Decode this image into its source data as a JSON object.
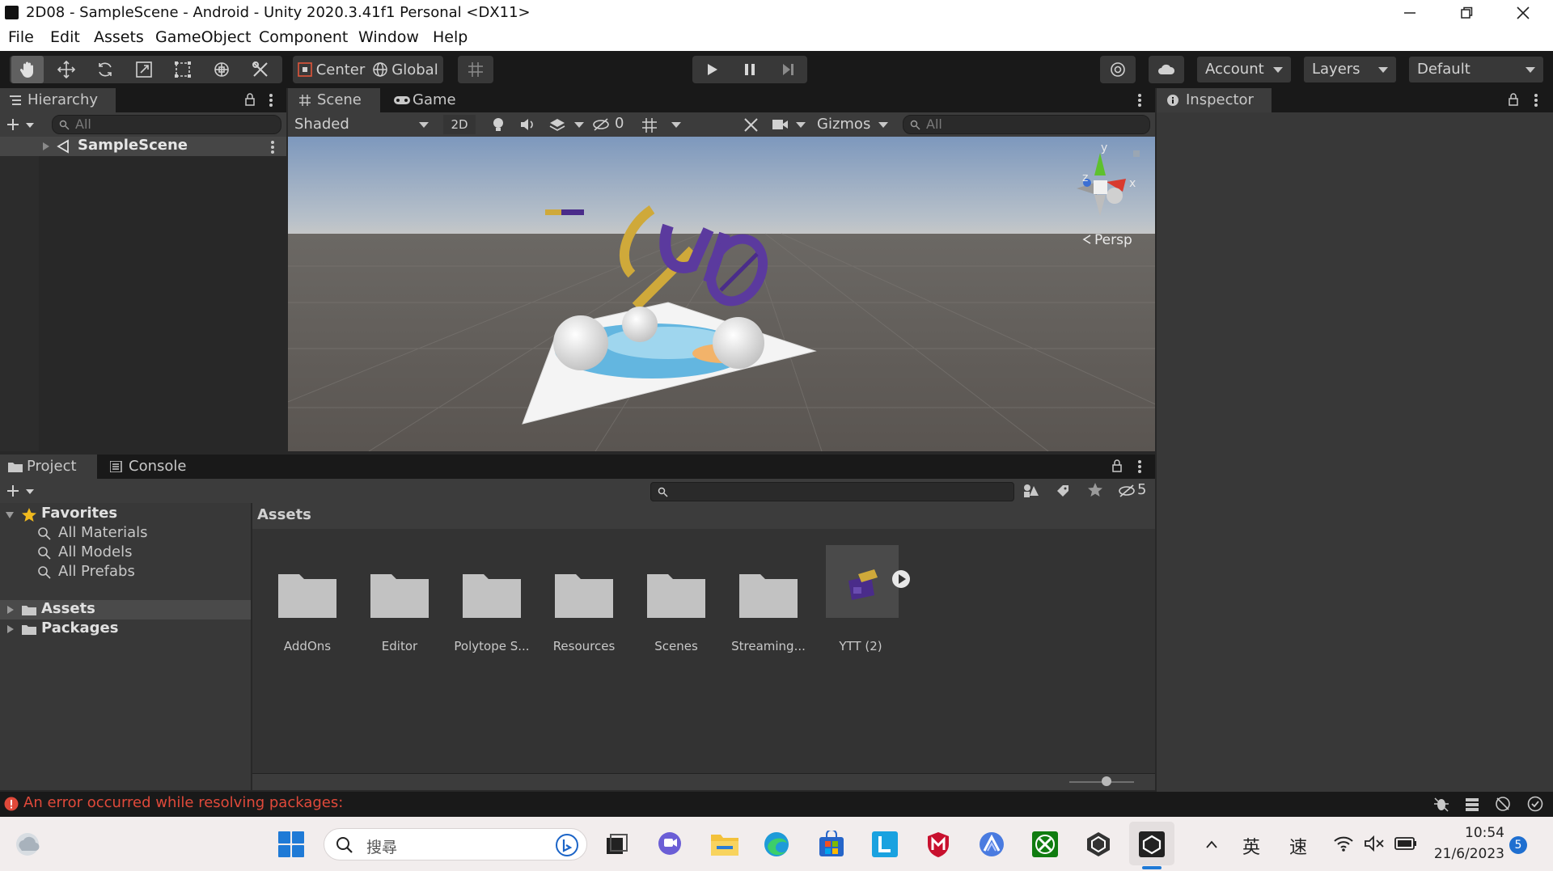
{
  "window": {
    "title": "2D08 - SampleScene - Android - Unity 2020.3.41f1 Personal <DX11>"
  },
  "menu": [
    "File",
    "Edit",
    "Assets",
    "GameObject",
    "Component",
    "Window",
    "Help"
  ],
  "toolbar": {
    "pivot_label": "Center",
    "space_label": "Global",
    "account_label": "Account",
    "layers_label": "Layers",
    "layout_label": "Default"
  },
  "hierarchy": {
    "tab_label": "Hierarchy",
    "search_placeholder": "All",
    "scene_name": "SampleScene"
  },
  "scene_view": {
    "tabs": [
      {
        "label": "Scene",
        "active": true
      },
      {
        "label": "Game",
        "active": false
      }
    ],
    "draw_mode": "Shaded",
    "mode_2d": "2D",
    "hidden_count": "0",
    "gizmos_label": "Gizmos",
    "search_placeholder": "All",
    "persp_label": "Persp",
    "axis_y": "y",
    "axis_x": "x",
    "axis_z": "z"
  },
  "inspector": {
    "tab_label": "Inspector"
  },
  "project": {
    "tabs": [
      {
        "label": "Project",
        "active": true
      },
      {
        "label": "Console",
        "active": false
      }
    ],
    "hidden_count": "5",
    "favorites_label": "Favorites",
    "favorites": [
      "All Materials",
      "All Models",
      "All Prefabs"
    ],
    "roots": [
      "Assets",
      "Packages"
    ],
    "breadcrumb": "Assets",
    "items": [
      {
        "name": "AddOns",
        "type": "folder"
      },
      {
        "name": "Editor",
        "type": "folder"
      },
      {
        "name": "Polytope S...",
        "type": "folder"
      },
      {
        "name": "Resources",
        "type": "folder"
      },
      {
        "name": "Scenes",
        "type": "folder"
      },
      {
        "name": "Streaming...",
        "type": "folder"
      },
      {
        "name": "YTT (2)",
        "type": "prefab"
      }
    ]
  },
  "status": {
    "error_text": "An error occurred while resolving packages:",
    "error_color": "#e0493a"
  },
  "taskbar": {
    "search_placeholder": "搜尋",
    "ime_lang": "英",
    "ime_mode": "速",
    "time": "10:54",
    "date": "21/6/2023",
    "notification_count": "5"
  }
}
